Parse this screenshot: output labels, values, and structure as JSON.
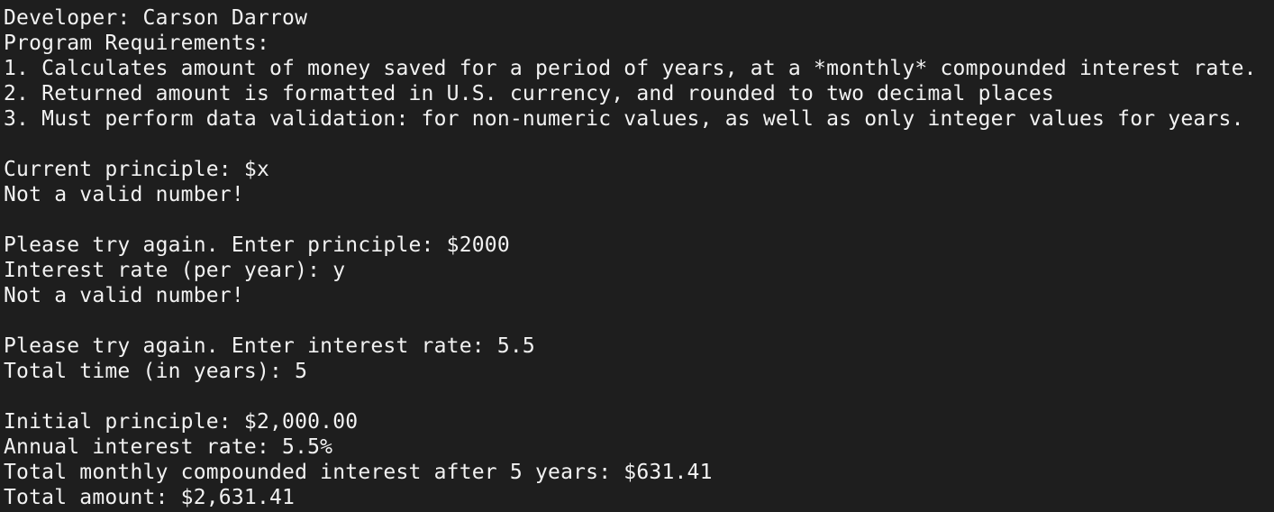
{
  "terminal": {
    "background": "#1e1e1e",
    "foreground": "#f2f2f2",
    "lines": [
      "Developer: Carson Darrow",
      "Program Requirements:",
      "1. Calculates amount of money saved for a period of years, at a *monthly* compounded interest rate.",
      "2. Returned amount is formatted in U.S. currency, and rounded to two decimal places",
      "3. Must perform data validation: for non-numeric values, as well as only integer values for years.",
      "",
      "Current principle: $x",
      "Not a valid number!",
      "",
      "Please try again. Enter principle: $2000",
      "Interest rate (per year): y",
      "Not a valid number!",
      "",
      "Please try again. Enter interest rate: 5.5",
      "Total time (in years): 5",
      "",
      "Initial principle: $2,000.00",
      "Annual interest rate: 5.5%",
      "Total monthly compounded interest after 5 years: $631.41",
      "Total amount: $2,631.41"
    ]
  }
}
